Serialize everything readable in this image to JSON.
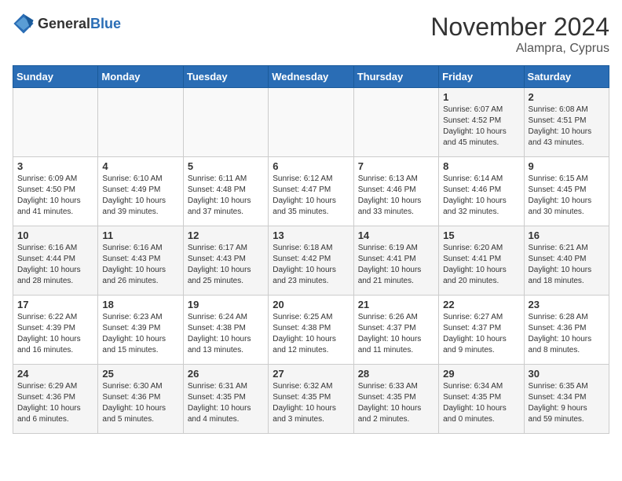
{
  "header": {
    "logo_general": "General",
    "logo_blue": "Blue",
    "month": "November 2024",
    "location": "Alampra, Cyprus"
  },
  "weekdays": [
    "Sunday",
    "Monday",
    "Tuesday",
    "Wednesday",
    "Thursday",
    "Friday",
    "Saturday"
  ],
  "weeks": [
    [
      {
        "day": "",
        "info": ""
      },
      {
        "day": "",
        "info": ""
      },
      {
        "day": "",
        "info": ""
      },
      {
        "day": "",
        "info": ""
      },
      {
        "day": "",
        "info": ""
      },
      {
        "day": "1",
        "info": "Sunrise: 6:07 AM\nSunset: 4:52 PM\nDaylight: 10 hours\nand 45 minutes."
      },
      {
        "day": "2",
        "info": "Sunrise: 6:08 AM\nSunset: 4:51 PM\nDaylight: 10 hours\nand 43 minutes."
      }
    ],
    [
      {
        "day": "3",
        "info": "Sunrise: 6:09 AM\nSunset: 4:50 PM\nDaylight: 10 hours\nand 41 minutes."
      },
      {
        "day": "4",
        "info": "Sunrise: 6:10 AM\nSunset: 4:49 PM\nDaylight: 10 hours\nand 39 minutes."
      },
      {
        "day": "5",
        "info": "Sunrise: 6:11 AM\nSunset: 4:48 PM\nDaylight: 10 hours\nand 37 minutes."
      },
      {
        "day": "6",
        "info": "Sunrise: 6:12 AM\nSunset: 4:47 PM\nDaylight: 10 hours\nand 35 minutes."
      },
      {
        "day": "7",
        "info": "Sunrise: 6:13 AM\nSunset: 4:46 PM\nDaylight: 10 hours\nand 33 minutes."
      },
      {
        "day": "8",
        "info": "Sunrise: 6:14 AM\nSunset: 4:46 PM\nDaylight: 10 hours\nand 32 minutes."
      },
      {
        "day": "9",
        "info": "Sunrise: 6:15 AM\nSunset: 4:45 PM\nDaylight: 10 hours\nand 30 minutes."
      }
    ],
    [
      {
        "day": "10",
        "info": "Sunrise: 6:16 AM\nSunset: 4:44 PM\nDaylight: 10 hours\nand 28 minutes."
      },
      {
        "day": "11",
        "info": "Sunrise: 6:16 AM\nSunset: 4:43 PM\nDaylight: 10 hours\nand 26 minutes."
      },
      {
        "day": "12",
        "info": "Sunrise: 6:17 AM\nSunset: 4:43 PM\nDaylight: 10 hours\nand 25 minutes."
      },
      {
        "day": "13",
        "info": "Sunrise: 6:18 AM\nSunset: 4:42 PM\nDaylight: 10 hours\nand 23 minutes."
      },
      {
        "day": "14",
        "info": "Sunrise: 6:19 AM\nSunset: 4:41 PM\nDaylight: 10 hours\nand 21 minutes."
      },
      {
        "day": "15",
        "info": "Sunrise: 6:20 AM\nSunset: 4:41 PM\nDaylight: 10 hours\nand 20 minutes."
      },
      {
        "day": "16",
        "info": "Sunrise: 6:21 AM\nSunset: 4:40 PM\nDaylight: 10 hours\nand 18 minutes."
      }
    ],
    [
      {
        "day": "17",
        "info": "Sunrise: 6:22 AM\nSunset: 4:39 PM\nDaylight: 10 hours\nand 16 minutes."
      },
      {
        "day": "18",
        "info": "Sunrise: 6:23 AM\nSunset: 4:39 PM\nDaylight: 10 hours\nand 15 minutes."
      },
      {
        "day": "19",
        "info": "Sunrise: 6:24 AM\nSunset: 4:38 PM\nDaylight: 10 hours\nand 13 minutes."
      },
      {
        "day": "20",
        "info": "Sunrise: 6:25 AM\nSunset: 4:38 PM\nDaylight: 10 hours\nand 12 minutes."
      },
      {
        "day": "21",
        "info": "Sunrise: 6:26 AM\nSunset: 4:37 PM\nDaylight: 10 hours\nand 11 minutes."
      },
      {
        "day": "22",
        "info": "Sunrise: 6:27 AM\nSunset: 4:37 PM\nDaylight: 10 hours\nand 9 minutes."
      },
      {
        "day": "23",
        "info": "Sunrise: 6:28 AM\nSunset: 4:36 PM\nDaylight: 10 hours\nand 8 minutes."
      }
    ],
    [
      {
        "day": "24",
        "info": "Sunrise: 6:29 AM\nSunset: 4:36 PM\nDaylight: 10 hours\nand 6 minutes."
      },
      {
        "day": "25",
        "info": "Sunrise: 6:30 AM\nSunset: 4:36 PM\nDaylight: 10 hours\nand 5 minutes."
      },
      {
        "day": "26",
        "info": "Sunrise: 6:31 AM\nSunset: 4:35 PM\nDaylight: 10 hours\nand 4 minutes."
      },
      {
        "day": "27",
        "info": "Sunrise: 6:32 AM\nSunset: 4:35 PM\nDaylight: 10 hours\nand 3 minutes."
      },
      {
        "day": "28",
        "info": "Sunrise: 6:33 AM\nSunset: 4:35 PM\nDaylight: 10 hours\nand 2 minutes."
      },
      {
        "day": "29",
        "info": "Sunrise: 6:34 AM\nSunset: 4:35 PM\nDaylight: 10 hours\nand 0 minutes."
      },
      {
        "day": "30",
        "info": "Sunrise: 6:35 AM\nSunset: 4:34 PM\nDaylight: 9 hours\nand 59 minutes."
      }
    ]
  ]
}
